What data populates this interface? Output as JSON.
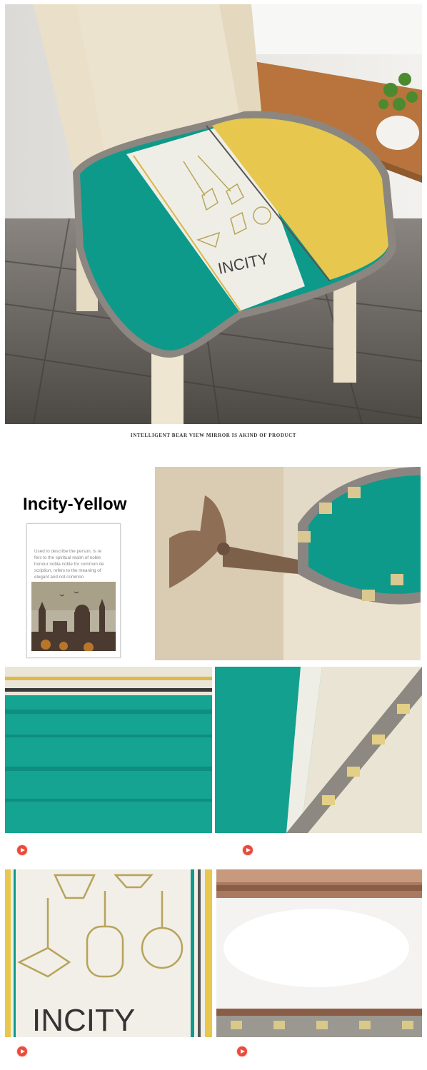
{
  "hero": {
    "logo_text": "INCITY"
  },
  "heading": {
    "title": "INTELLIGENT BEAR VIEW MIRROR IS AKIND OF PRODUCT",
    "subtitle": ""
  },
  "variant": {
    "label": "Incity-Yellow"
  },
  "card": {
    "text_lines": [
      "Used to describe the person, is re",
      "fers to the spiritual realm of noble",
      "honour nobla noble for common de",
      "scription, refers to the meaning of",
      "elegant and not common"
    ]
  },
  "detail_logo": {
    "text": "INCITY"
  },
  "colors": {
    "teal": "#0e9a8a",
    "yellow": "#e7c74d",
    "cream": "#efeee6",
    "play": "#e94b3c"
  },
  "icons": [
    "play-icon"
  ]
}
